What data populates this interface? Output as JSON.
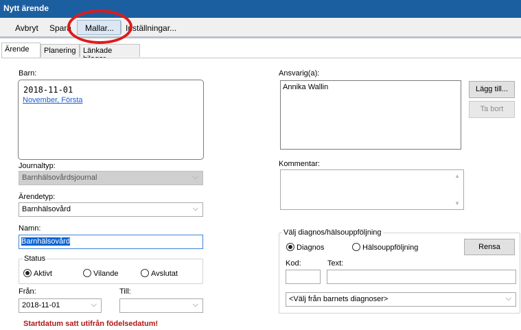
{
  "window": {
    "title": "Nytt ärende"
  },
  "menu": {
    "cancel": "Avbryt",
    "save": "Spara",
    "templates": "Mallar...",
    "settings": "Inställningar..."
  },
  "tabs": [
    "Ärende",
    "Planering",
    "Länkade bilagor"
  ],
  "barn": {
    "label": "Barn:",
    "date": "2018-11-01",
    "name_link": "November, Första"
  },
  "journaltyp": {
    "label": "Journaltyp:",
    "value": "Barnhälsovårdsjournal"
  },
  "arendetyp": {
    "label": "Ärendetyp:",
    "value": "Barnhälsovård"
  },
  "namn": {
    "label": "Namn:",
    "value": "Barnhälsovård"
  },
  "status": {
    "legend": "Status",
    "options": [
      "Aktivt",
      "Vilande",
      "Avslutat"
    ],
    "selected": "Aktivt"
  },
  "fran": {
    "label": "Från:",
    "value": "2018-11-01"
  },
  "till": {
    "label": "Till:",
    "value": ""
  },
  "warning": "Startdatum satt utifrån födelsedatum!",
  "ansvarig": {
    "label": "Ansvarig(a):",
    "items": [
      "Annika Wallin"
    ],
    "add_button": "Lägg till...",
    "remove_button": "Ta bort"
  },
  "kommentar": {
    "label": "Kommentar:",
    "value": ""
  },
  "diagnos": {
    "legend": "Välj diagnos/hälsouppföljning",
    "options": [
      "Diagnos",
      "Hälsouppföljning"
    ],
    "selected": "Diagnos",
    "clear_button": "Rensa",
    "kod_label": "Kod:",
    "text_label": "Text:",
    "kod_value": "",
    "text_value": "",
    "select_placeholder": "<Välj från barnets diagnoser>"
  },
  "colors": {
    "titlebar": "#1c5fa0",
    "highlight": "#e01a1a",
    "warning": "#b01818",
    "link": "#1a5fd0"
  }
}
